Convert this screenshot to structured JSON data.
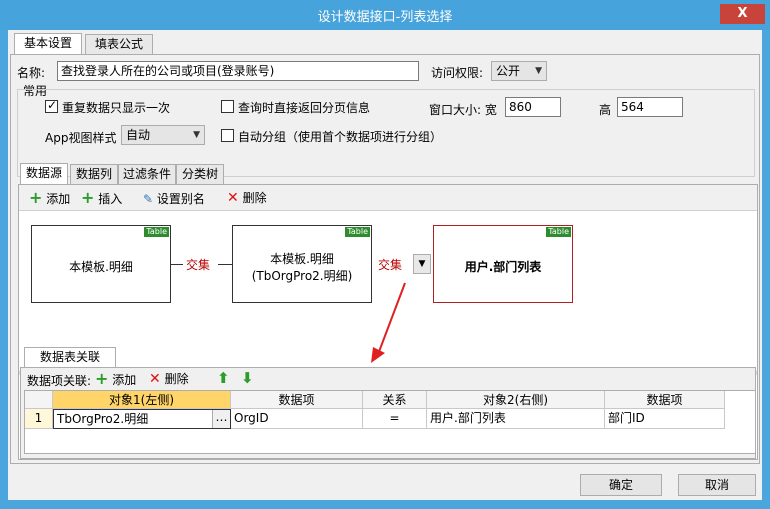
{
  "window": {
    "title": "设计数据接口-列表选择",
    "close_glyph": "X"
  },
  "top_tabs": [
    "基本设置",
    "填表公式"
  ],
  "basic": {
    "name_label": "名称:",
    "name_value": "查找登录人所在的公司或项目(登录账号)",
    "access_label": "访问权限:",
    "access_value": "公开",
    "common_group": "常用",
    "dedupe_label": "重复数据只显示一次",
    "paging_label": "查询时直接返回分页信息",
    "window_size_label": "窗口大小: 宽",
    "width_value": "860",
    "height_label": "高",
    "height_value": "564",
    "app_view_label": "App视图样式",
    "app_view_value": "自动",
    "autogroup_label": "自动分组（使用首个数据项进行分组）"
  },
  "inner_tabs": [
    "数据源",
    "数据列",
    "过滤条件",
    "分类树"
  ],
  "toolbar": {
    "add": "添加",
    "insert": "插入",
    "alias": "设置别名",
    "delete": "删除"
  },
  "diagram": {
    "node1": "本模板.明细",
    "node2_line1": "本模板.明细",
    "node2_line2": "(TbOrgPro2.明细)",
    "node3": "用户.部门列表",
    "table_tag": "Table",
    "join1": "交集",
    "join2": "交集"
  },
  "relation": {
    "tab_label": "数据表关联",
    "field_rel_label": "数据项关联:",
    "add": "添加",
    "delete": "删除",
    "columns": [
      "对象1(左侧)",
      "数据项",
      "关系",
      "对象2(右侧)",
      "数据项"
    ],
    "rows": [
      {
        "index": "1",
        "obj1": "TbOrgPro2.明细",
        "field1": "OrgID",
        "rel": "=",
        "obj2": "用户.部门列表",
        "field2": "部门ID"
      }
    ]
  },
  "buttons": {
    "ok": "确定",
    "cancel": "取消"
  }
}
